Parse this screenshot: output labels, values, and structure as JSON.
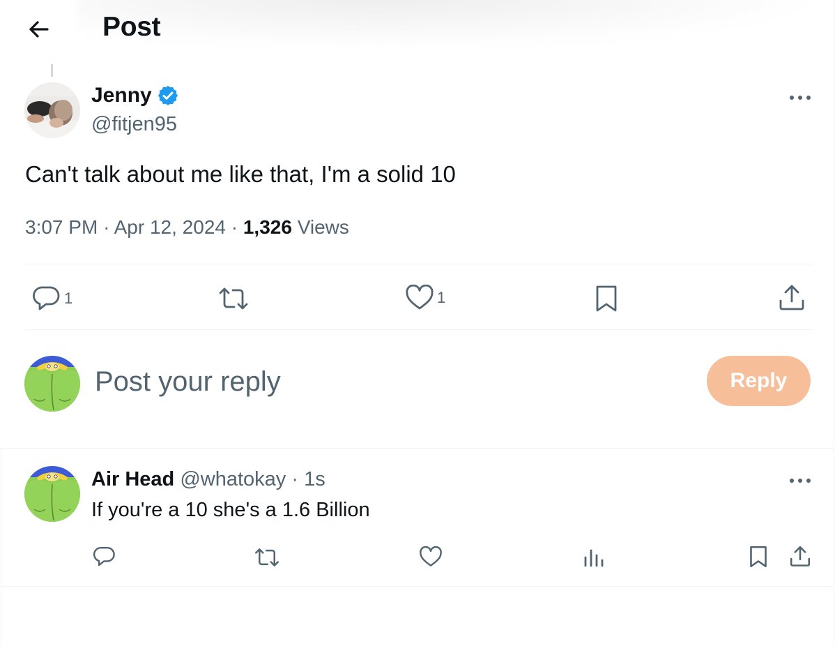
{
  "header": {
    "title": "Post"
  },
  "post": {
    "author": {
      "display_name": "Jenny",
      "handle": "@fitjen95",
      "verified": true
    },
    "text": "Can't talk about me like that, I'm a solid 10",
    "time": "3:07 PM",
    "date": "Apr 12, 2024",
    "separator": "·",
    "views_count": "1,326",
    "views_label": "Views",
    "actions": {
      "reply_count": "1",
      "like_count": "1"
    }
  },
  "composer": {
    "placeholder": "Post your reply",
    "reply_button_label": "Reply"
  },
  "replies": [
    {
      "display_name": "Air Head",
      "handle": "@whatokay",
      "separator": "·",
      "time": "1s",
      "text": "If you're a 10 she's a 1.6 Billion"
    }
  ],
  "colors": {
    "text_primary": "#0f1419",
    "text_secondary": "#536471",
    "verified_blue": "#1d9bf0",
    "reply_button_disabled": "#f6bf9a",
    "divider": "#eff3f4"
  },
  "icons": {
    "back": "arrow-left-icon",
    "verified": "verified-badge-icon",
    "more": "more-horizontal-icon",
    "reply": "reply-bubble-icon",
    "repost": "repost-icon",
    "like": "heart-icon",
    "bookmark": "bookmark-icon",
    "share": "share-icon",
    "views": "analytics-icon"
  }
}
